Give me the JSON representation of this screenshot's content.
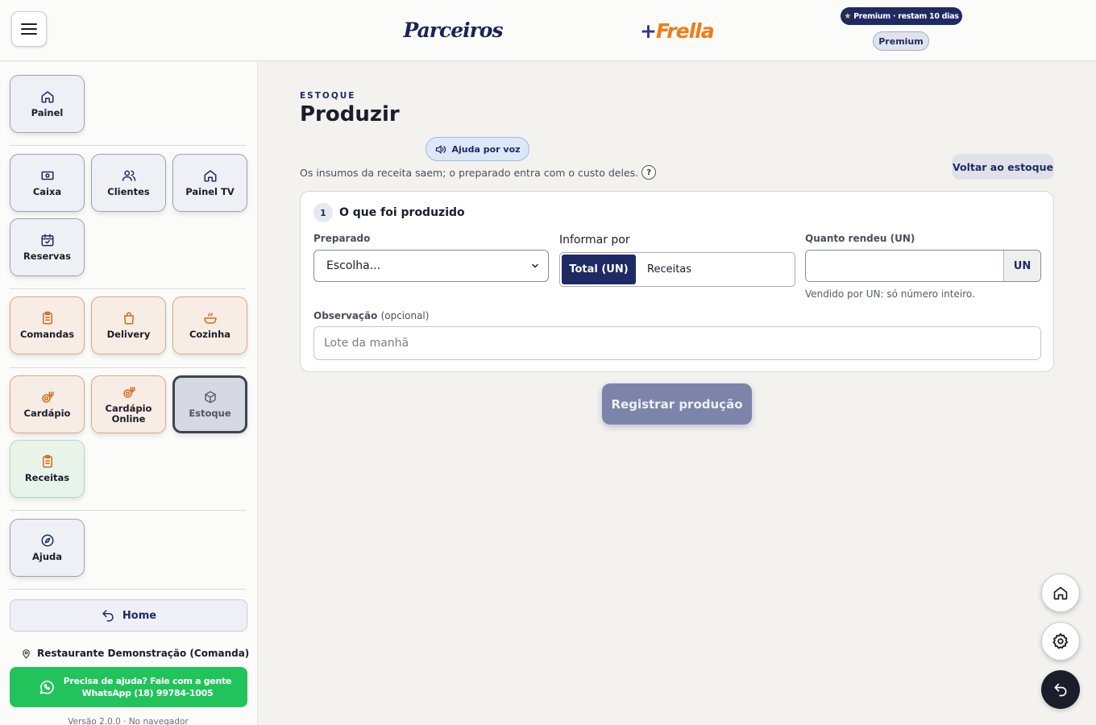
{
  "header": {
    "logo_left": "Parceiros",
    "logo_right_plus": "+",
    "logo_right_name": "Frella",
    "premium_banner": "Premium · restam 10 dias",
    "premium_pill": "Premium"
  },
  "sidebar": {
    "items": [
      {
        "label": "Painel",
        "icon": "home-icon"
      },
      {
        "label": "Caixa",
        "icon": "cash-icon"
      },
      {
        "label": "Clientes",
        "icon": "users-icon"
      },
      {
        "label": "Painel TV",
        "icon": "home-icon"
      },
      {
        "label": "Reservas",
        "icon": "calendar-check-icon"
      },
      {
        "label": "Comandas",
        "icon": "clipboard-icon"
      },
      {
        "label": "Delivery",
        "icon": "bag-icon"
      },
      {
        "label": "Cozinha",
        "icon": "cooking-pot-icon"
      },
      {
        "label": "Cardápio",
        "icon": "menu-dish-icon"
      },
      {
        "label": "Cardápio Online",
        "icon": "menu-dish-icon"
      },
      {
        "label": "Estoque",
        "icon": "box-icon"
      },
      {
        "label": "Receitas",
        "icon": "clipboard-icon"
      },
      {
        "label": "Ajuda",
        "icon": "compass-icon"
      }
    ],
    "active": "Estoque",
    "home_label": "Home",
    "restaurant": "Restaurante Demonstração (Comanda)",
    "whatsapp_line1": "Precisa de ajuda? Fale com a gente",
    "whatsapp_line2": "WhatsApp (18) 99784-1005",
    "version": "Versão 2.0.0 · No navegador"
  },
  "main": {
    "eyebrow": "ESTOQUE",
    "title": "Produzir",
    "voice_help": "Ajuda por voz",
    "subtitle": "Os insumos da receita saem; o preparado entra com o custo deles.",
    "help_glyph": "?",
    "back_button": "Voltar ao estoque",
    "form": {
      "step_number": "1",
      "step_title": "O que foi produzido",
      "preparado_label": "Preparado",
      "preparado_value": "Escolha...",
      "informar_label": "Informar por",
      "informar_options": [
        "Total (UN)",
        "Receitas"
      ],
      "informar_selected": "Total (UN)",
      "quantidade_label": "Quanto rendeu (UN)",
      "quantidade_value": "",
      "quantidade_unit": "UN",
      "quantidade_hint": "Vendido por UN: só número inteiro.",
      "obs_label": "Observação",
      "obs_optional": "(opcional)",
      "obs_placeholder": "Lote da manhã"
    },
    "submit": "Registrar produção"
  },
  "colors": {
    "brand_navy": "#1e2a64",
    "brand_orange": "#f07b16",
    "whatsapp_green": "#23c35c",
    "submit_disabled": "#7c84a9"
  }
}
